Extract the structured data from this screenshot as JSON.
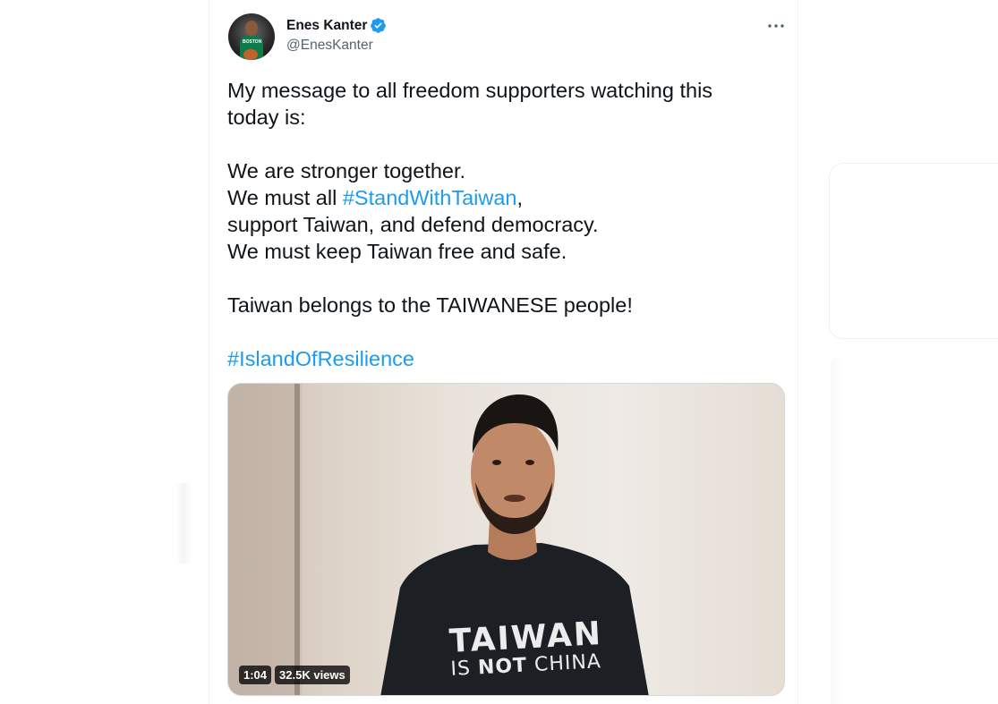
{
  "tweet": {
    "author": {
      "display_name": "Enes Kanter",
      "handle": "@EnesKanter",
      "verified": true,
      "avatar_jersey_text": "BOSTON"
    },
    "text_lines": [
      {
        "pre": "My message to all freedom supporters watching this",
        "tag": "",
        "post": ""
      },
      {
        "pre": "today is:",
        "tag": "",
        "post": ""
      },
      {
        "blank": true
      },
      {
        "pre": "We are stronger together.",
        "tag": "",
        "post": ""
      },
      {
        "pre": "We must all ",
        "tag": "#StandWithTaiwan",
        "post": ","
      },
      {
        "pre": "support Taiwan, and defend democracy.",
        "tag": "",
        "post": ""
      },
      {
        "pre": "We must keep Taiwan free and safe.",
        "tag": "",
        "post": ""
      },
      {
        "blank": true
      },
      {
        "pre": "Taiwan belongs to the TAIWANESE people!",
        "tag": "",
        "post": ""
      },
      {
        "blank": true
      },
      {
        "pre": "",
        "tag": "#IslandOfResilience",
        "post": ""
      }
    ],
    "video": {
      "duration": "1:04",
      "views": "32.5K views",
      "shirt_line1": "TAIWAN",
      "shirt_line2_pre": "IS ",
      "shirt_line2_bold": "NOT",
      "shirt_line2_post": " CHINA"
    }
  },
  "colors": {
    "link": "#1d9bf0",
    "verified": "#1d9bf0",
    "text": "#0f1419",
    "secondary": "#536471"
  },
  "icons": {
    "verified": "verified-badge-icon",
    "more": "more-dots-icon"
  }
}
